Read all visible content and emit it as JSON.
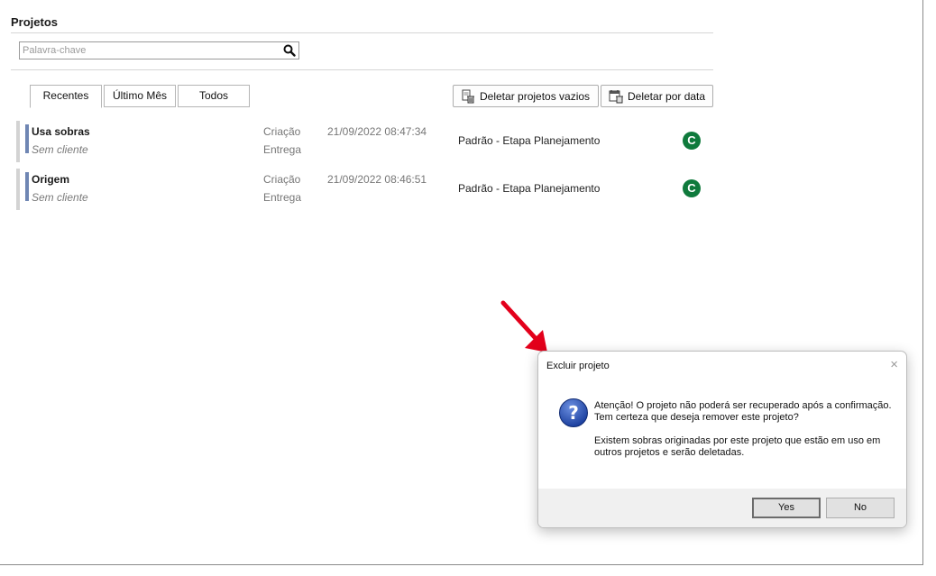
{
  "page": {
    "title": "Projetos"
  },
  "search": {
    "placeholder": "Palavra-chave",
    "value": ""
  },
  "tabs": [
    {
      "label": "Recentes",
      "active": true
    },
    {
      "label": "Último Mês",
      "active": false
    },
    {
      "label": "Todos",
      "active": false
    }
  ],
  "actions": {
    "delete_empty": "Deletar projetos vazios",
    "delete_by_date": "Deletar por data"
  },
  "projects": [
    {
      "name": "Usa sobras",
      "client": "Sem cliente",
      "created_label": "Criação",
      "delivery_label": "Entrega",
      "created_date": "21/09/2022 08:47:34",
      "stage": "Padrão - Etapa Planejamento",
      "status_badge": "C"
    },
    {
      "name": "Origem",
      "client": "Sem cliente",
      "created_label": "Criação",
      "delivery_label": "Entrega",
      "created_date": "21/09/2022 08:46:51",
      "stage": "Padrão - Etapa Planejamento",
      "status_badge": "C"
    }
  ],
  "dialog": {
    "title": "Excluir projeto",
    "close_icon": "×",
    "message_line1": "Atenção! O projeto não poderá ser recuperado após a confirmação.",
    "message_line2": "Tem certeza que deseja remover este projeto?",
    "message_line3": "Existem sobras originadas por este projeto que estão em uso em outros projetos e serão deletadas.",
    "yes_label": "Yes",
    "no_label": "No"
  },
  "colors": {
    "status_badge": "#0f7a3c",
    "row_accent": "#6f86b3",
    "arrow": "#e3001b"
  }
}
